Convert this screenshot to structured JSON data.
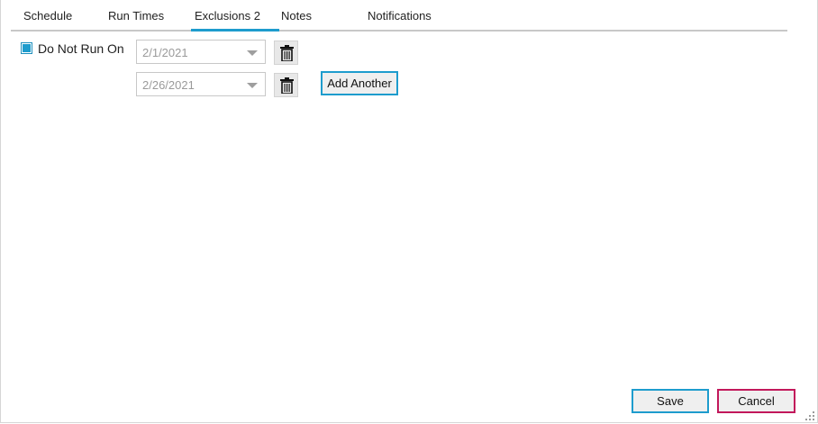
{
  "tabs": [
    {
      "label": "Schedule"
    },
    {
      "label": "Run Times"
    },
    {
      "label": "Exclusions 2"
    },
    {
      "label": "Notes"
    },
    {
      "label": "Notifications"
    }
  ],
  "active_tab": "Exclusions 2",
  "accent_color": "#1e9ccd",
  "cancel_color": "#c2185b",
  "exclusions": {
    "checkbox_label": "Do Not Run On",
    "checked": true,
    "dates": [
      {
        "value": "2/1/2021"
      },
      {
        "value": "2/26/2021"
      }
    ],
    "add_another_label": "Add Another"
  },
  "footer": {
    "save_label": "Save",
    "cancel_label": "Cancel"
  },
  "icons": {
    "dropdown": "chevron-down-icon",
    "delete": "trash-icon",
    "resize": "resize-grip-icon"
  }
}
